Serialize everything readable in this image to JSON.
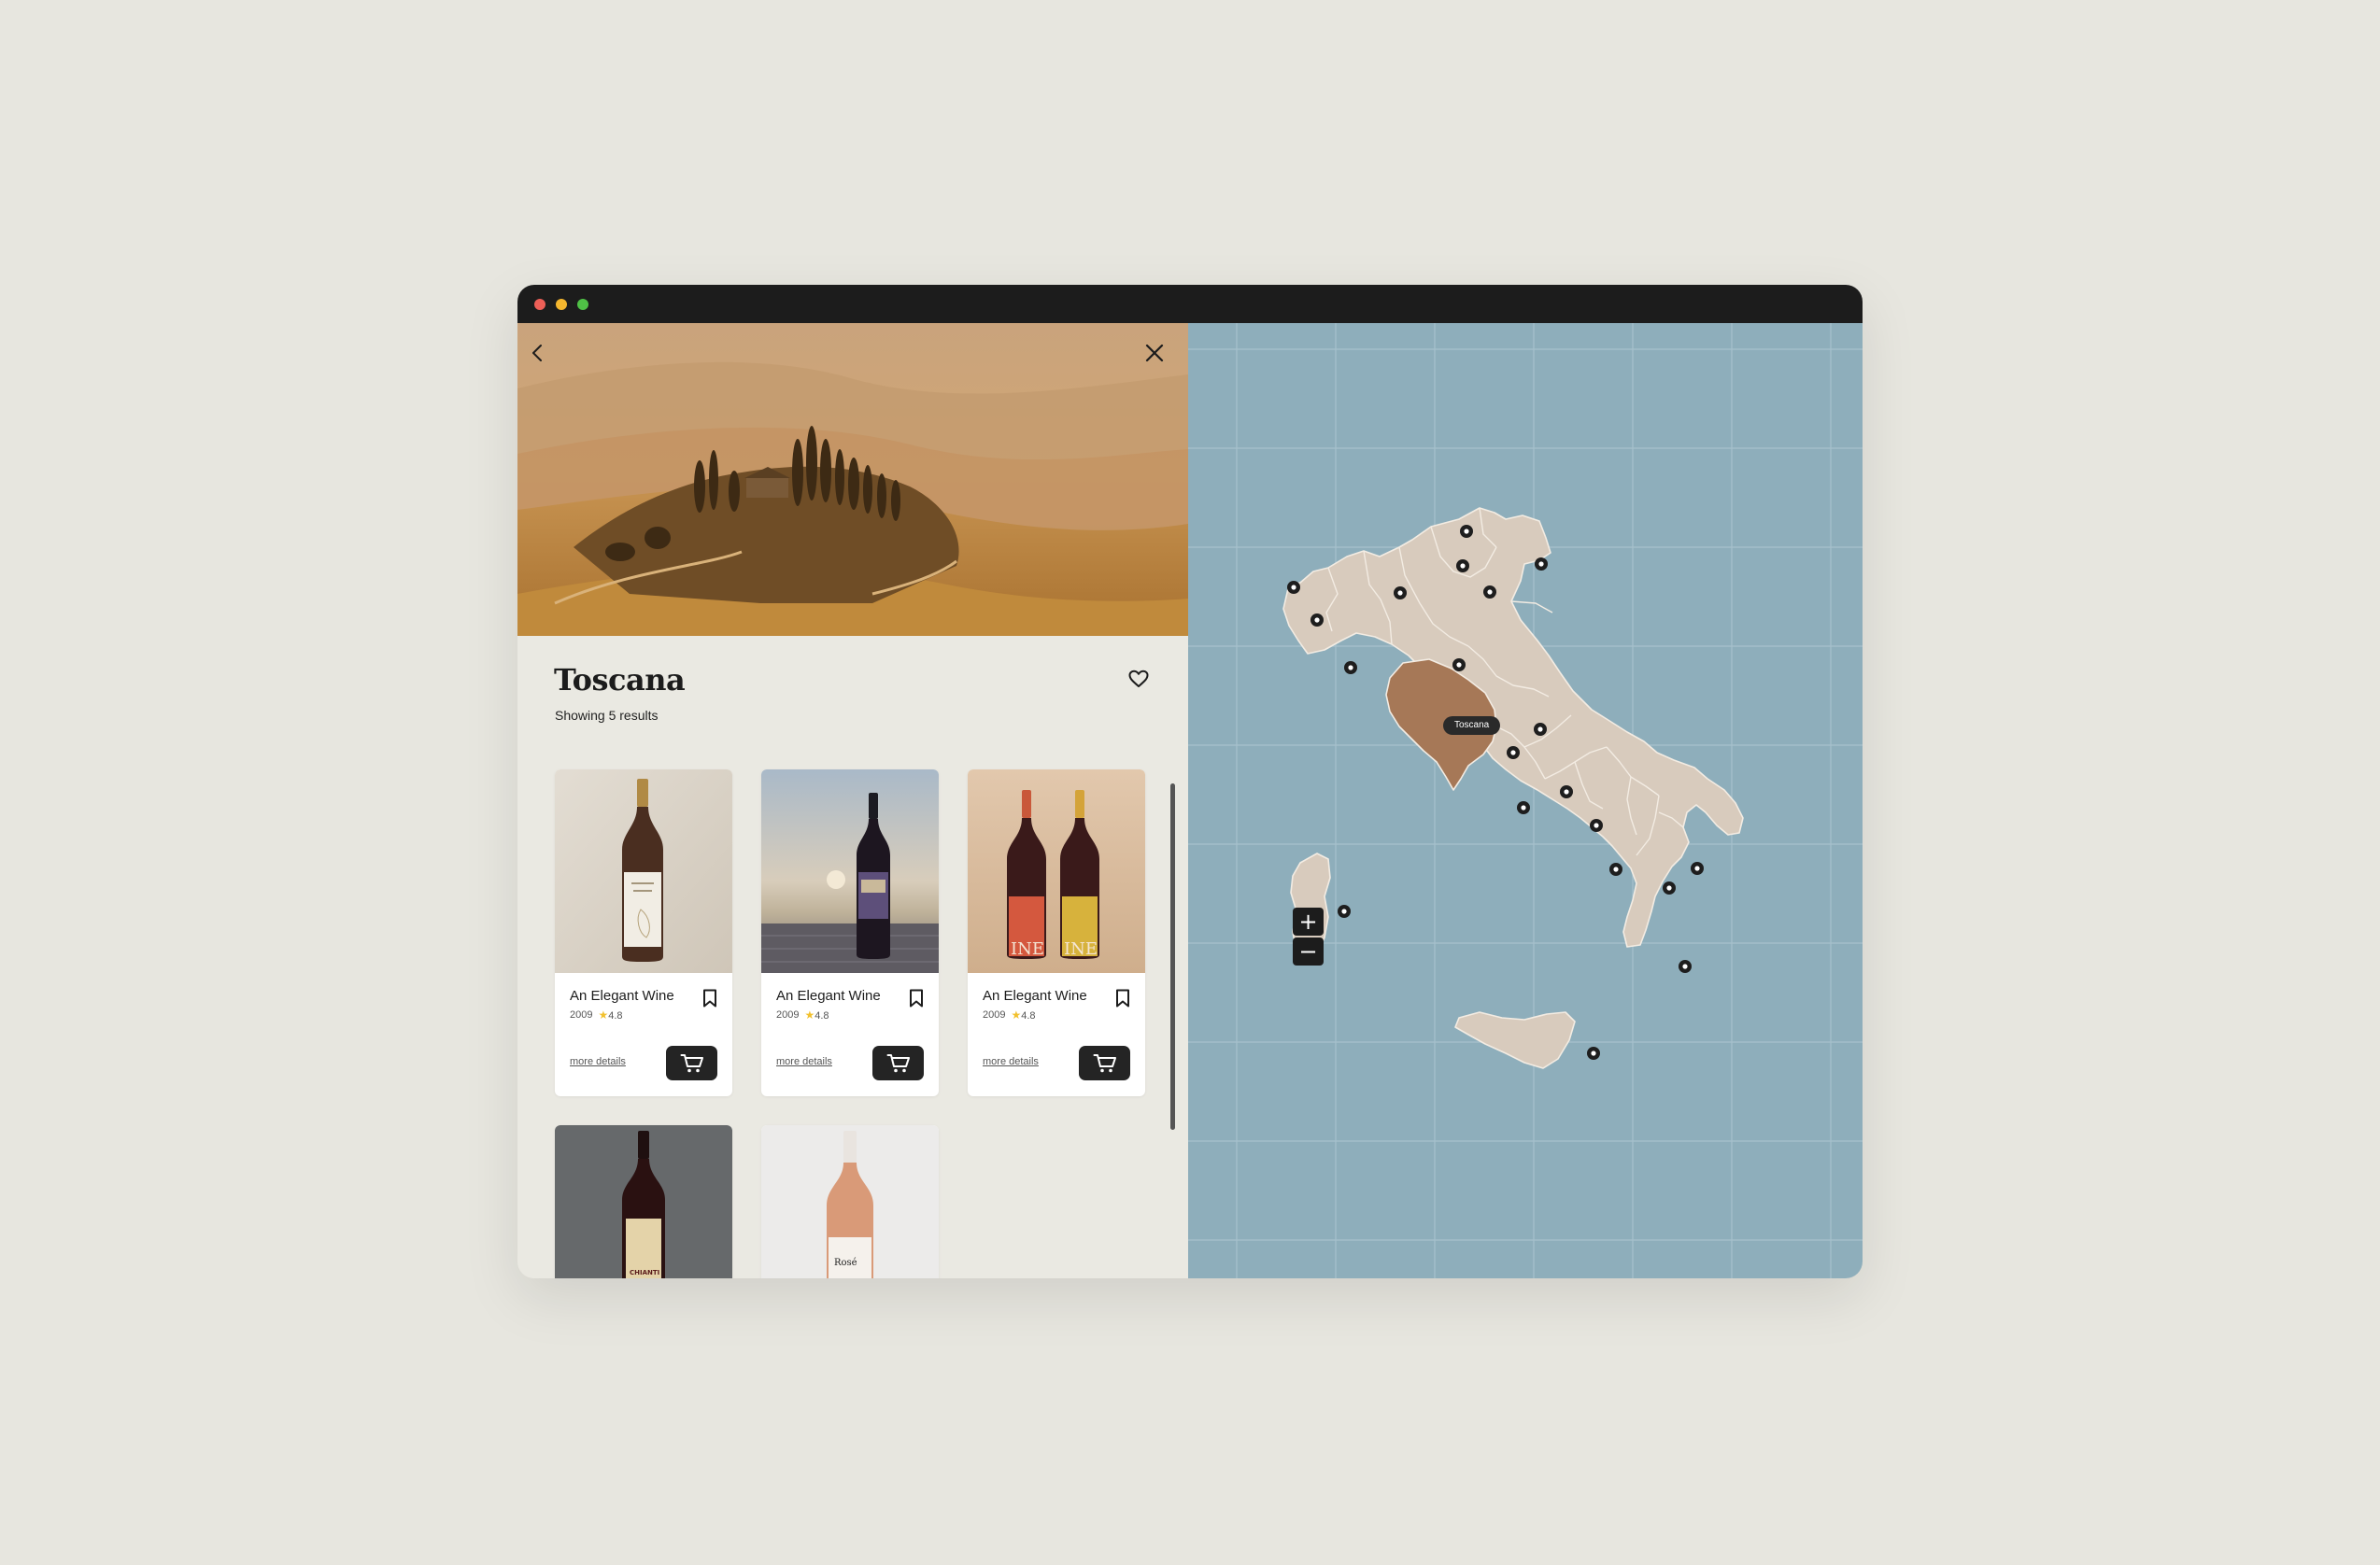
{
  "window": {
    "controls": [
      "close",
      "minimize",
      "maximize"
    ]
  },
  "hero": {
    "back_icon": "chevron-left-icon",
    "close_icon": "close-icon"
  },
  "region": {
    "title": "Toscana",
    "results_text": "Showing 5 results",
    "favorite_icon": "heart-icon"
  },
  "wines": [
    {
      "name": "An Elegant Wine",
      "year": "2009",
      "rating": "4.8",
      "details_label": "more details"
    },
    {
      "name": "An Elegant Wine",
      "year": "2009",
      "rating": "4.8",
      "details_label": "more details"
    },
    {
      "name": "An Elegant Wine",
      "year": "2009",
      "rating": "4.8",
      "details_label": "more details"
    }
  ],
  "partial_wines": [
    {
      "label": "CHIANTI"
    },
    {
      "label": "Rosé"
    }
  ],
  "map": {
    "selected_region": "Toscana",
    "zoom_in_label": "+",
    "zoom_out_label": "−",
    "land_color": "#d8cbbd",
    "selected_color": "#a67857",
    "sea_color": "#8eaebb"
  }
}
